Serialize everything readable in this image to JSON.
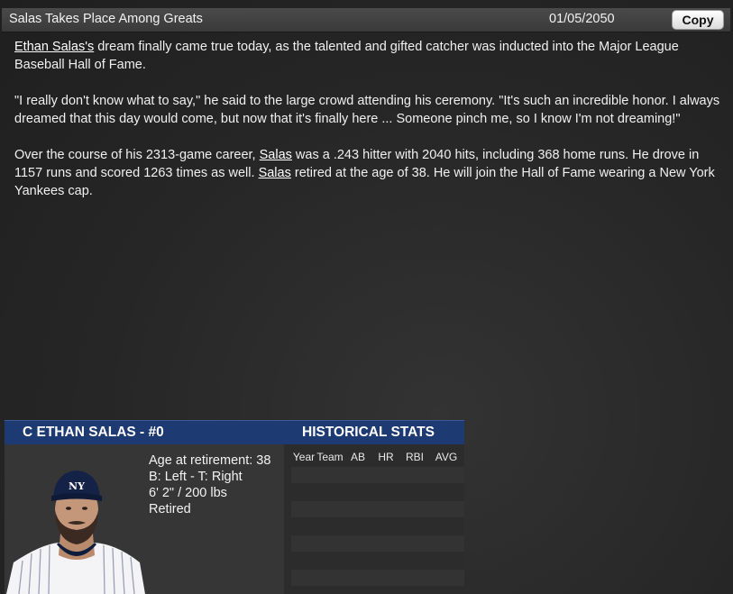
{
  "header": {
    "title": "Salas Takes Place Among Greats",
    "date": "01/05/2050",
    "copy_label": "Copy"
  },
  "article": {
    "p1_link": "Ethan Salas's",
    "p1_text": " dream finally came true today, as the talented and gifted catcher was inducted into the Major League Baseball Hall of Fame.",
    "p2_text": "\"I really don't know what to say,\" he said to the large crowd attending his ceremony. \"It's such an incredible honor. I always dreamed that this day would come, but now that it's finally here ... Someone pinch me, so I know I'm not dreaming!\"",
    "p3_a": "Over the course of his 2313-game career, ",
    "p3_link1": "Salas",
    "p3_b": " was a .243 hitter with 2040 hits, including 368 home runs. He drove in 1157 runs and scored 1263 times as well. ",
    "p3_link2": "Salas",
    "p3_c": " retired at the age of 38.  He will join the Hall of Fame wearing a New York Yankees cap."
  },
  "player": {
    "name": "C ETHAN SALAS - #0",
    "age": "Age at retirement: 38",
    "bats_throws": "B: Left - T: Right",
    "size": "6' 2\" / 200 lbs",
    "status": "Retired",
    "avatar_icon": "player-portrait"
  },
  "stats": {
    "title": "HISTORICAL STATS",
    "columns": [
      "Year",
      "Team",
      "AB",
      "HR",
      "RBI",
      "AVG"
    ]
  },
  "colors": {
    "panel_header": "#1d3a72",
    "background": "#2a2a2a"
  }
}
